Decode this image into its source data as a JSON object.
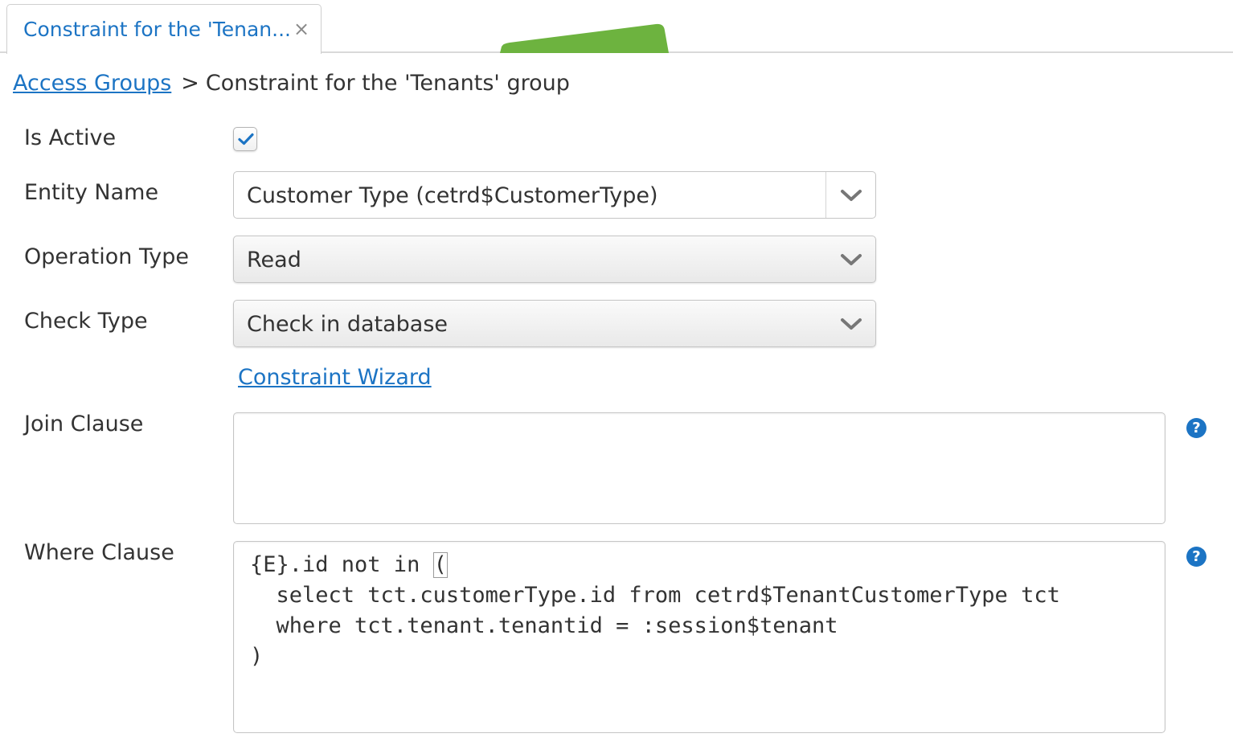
{
  "tab": {
    "title": "Constraint for the 'Tenan...",
    "close_glyph": "×"
  },
  "breadcrumb": {
    "link": "Access Groups",
    "separator": ">",
    "current": "Constraint for the 'Tenants' group"
  },
  "form": {
    "is_active": {
      "label": "Is Active",
      "checked": true
    },
    "entity_name": {
      "label": "Entity Name",
      "value": "Customer Type (cetrd$CustomerType)"
    },
    "operation_type": {
      "label": "Operation Type",
      "value": "Read"
    },
    "check_type": {
      "label": "Check Type",
      "value": "Check in database"
    },
    "wizard_link": "Constraint Wizard",
    "join_clause": {
      "label": "Join Clause",
      "value": ""
    },
    "where_clause": {
      "label": "Where Clause",
      "line1_prefix": "{E}.id not in ",
      "line1_cursor": "(",
      "rest": "  select tct.customerType.id from cetrd$TenantCustomerType tct\n  where tct.tenant.tenantid = :session$tenant\n)"
    },
    "help_glyph": "?"
  },
  "colors": {
    "accent": "#1c74c4",
    "text": "#333333",
    "decoration_green": "#6db33f"
  },
  "icons": [
    "close-icon",
    "checkmark-icon",
    "chevron-down-icon",
    "help-icon"
  ]
}
